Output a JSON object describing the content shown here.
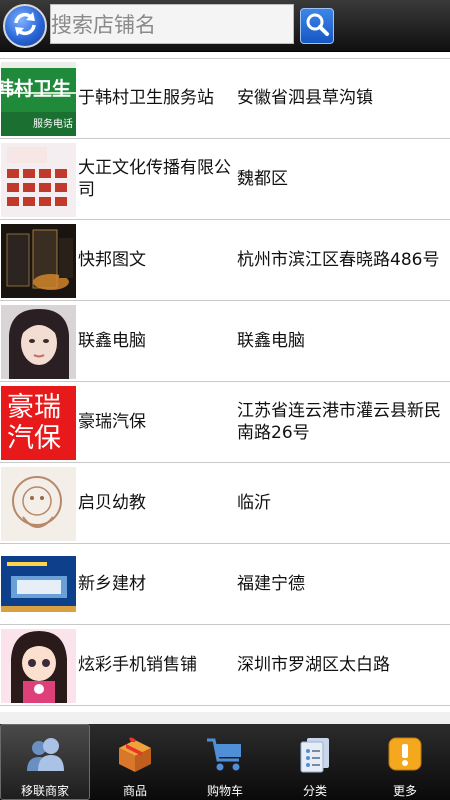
{
  "search": {
    "placeholder": "搜索店铺名"
  },
  "stores": [
    {
      "name": "于韩村卫生服务站",
      "address": "安徽省泗县草沟镇",
      "thumb_text": "韩村卫生",
      "thumb_sub": "服务电话"
    },
    {
      "name": "大正文化传播有限公司",
      "address": "魏都区",
      "thumb_text": ""
    },
    {
      "name": "快邦图文",
      "address": "杭州市滨江区春晓路486号",
      "thumb_text": ""
    },
    {
      "name": "联鑫电脑",
      "address": "联鑫电脑",
      "thumb_text": ""
    },
    {
      "name": "豪瑞汽保",
      "address": "江苏省连云港市灌云县新民南路26号",
      "thumb_text": "豪瑞汽保"
    },
    {
      "name": "启贝幼教",
      "address": "临沂",
      "thumb_text": ""
    },
    {
      "name": "新乡建材",
      "address": "福建宁德",
      "thumb_text": ""
    },
    {
      "name": "炫彩手机销售铺",
      "address": "深圳市罗湖区太白路",
      "thumb_text": ""
    }
  ],
  "tabs": [
    {
      "label": "移联商家",
      "icon": "merchant-icon",
      "active": true
    },
    {
      "label": "商品",
      "icon": "gift-box-icon",
      "active": false
    },
    {
      "label": "购物车",
      "icon": "shopping-cart-icon",
      "active": false
    },
    {
      "label": "分类",
      "icon": "category-icon",
      "active": false
    },
    {
      "label": "更多",
      "icon": "more-icon",
      "active": false
    }
  ],
  "colors": {
    "topbar": "#1c1c1c",
    "accent_blue": "#2a66d8",
    "tabbar": "#141414",
    "thumb_red": "#e8191a"
  }
}
